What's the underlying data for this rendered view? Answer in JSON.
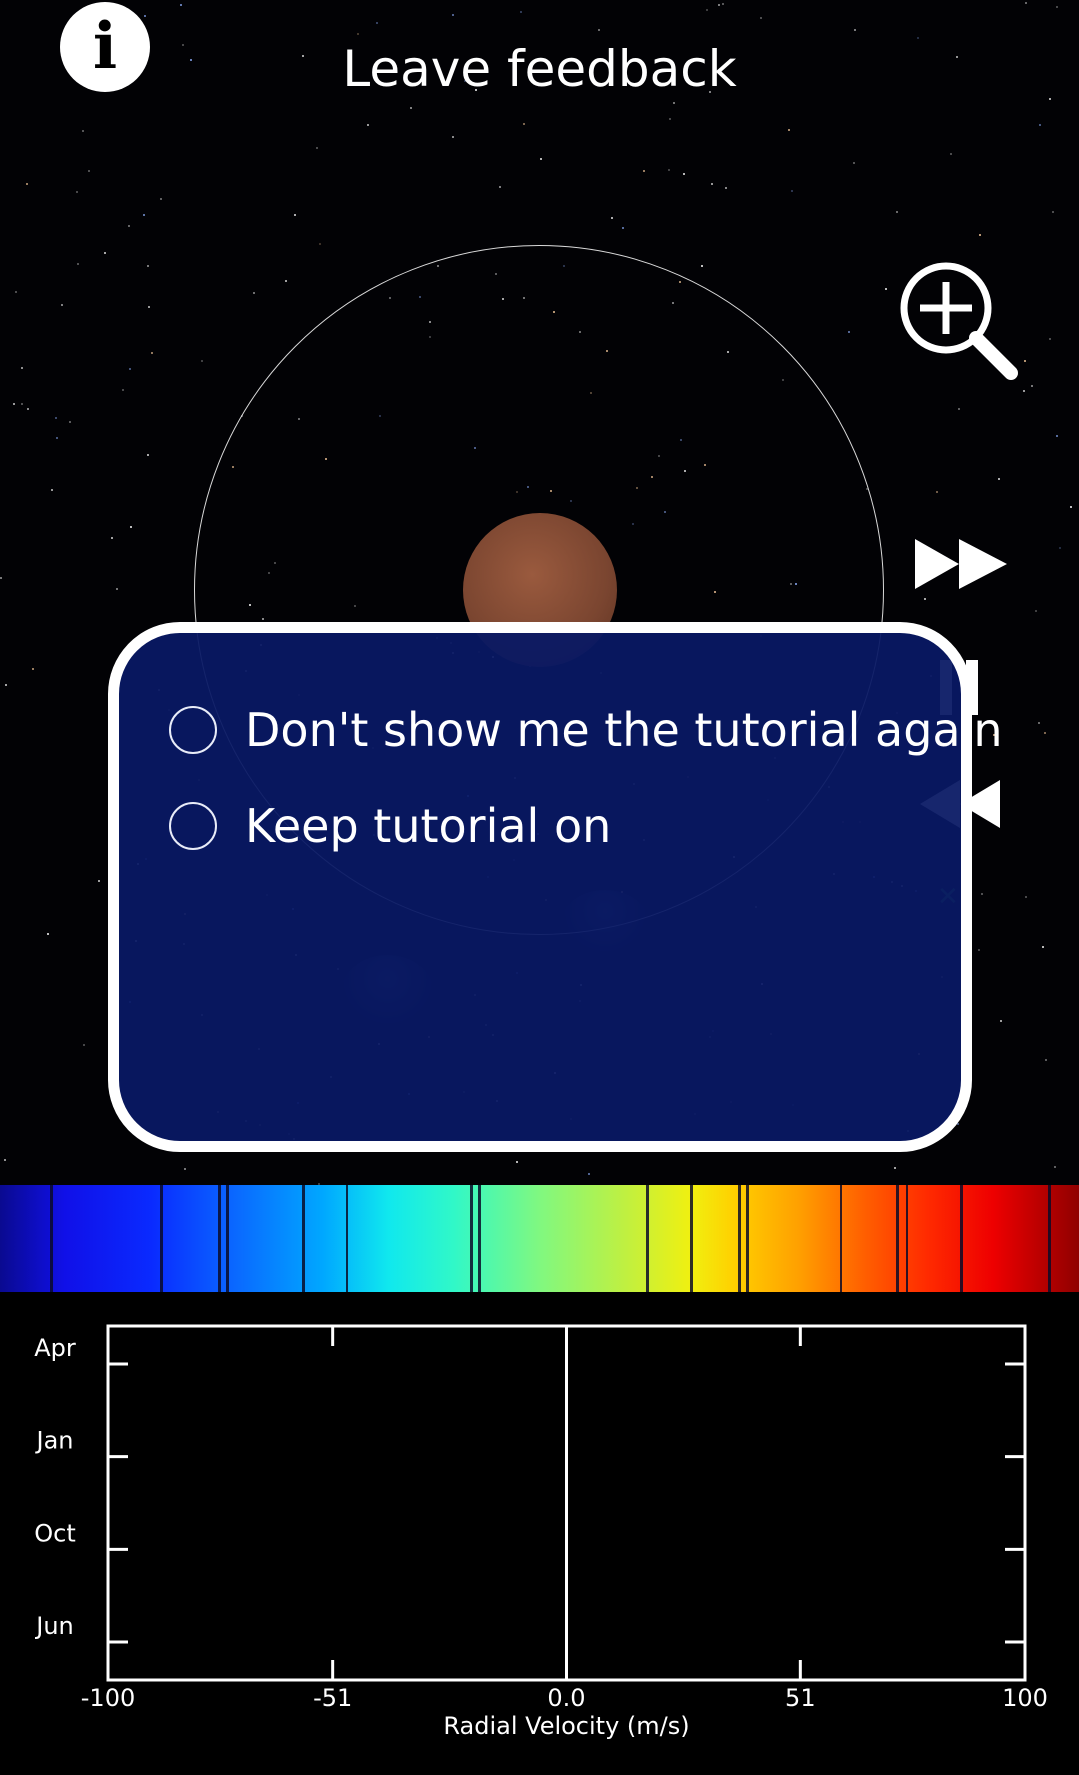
{
  "header": {
    "feedback_label": "Leave feedback"
  },
  "icons": {
    "info": "info-icon",
    "zoom_in": "zoom-in-icon",
    "fast_forward": "fast-forward-icon",
    "pause": "pause-icon",
    "rewind": "rewind-icon"
  },
  "tutorial_dialog": {
    "options": [
      {
        "label": "Don't show me the tutorial again",
        "selected": false
      },
      {
        "label": "Keep tutorial on",
        "selected": false
      }
    ]
  },
  "chart_data": {
    "type": "scatter",
    "title": "",
    "xlabel": "Radial Velocity (m/s)",
    "ylabel": "",
    "xlim": [
      -100,
      100
    ],
    "x_ticks": [
      "-100",
      "-51",
      "0.0",
      "51",
      "100"
    ],
    "x_tick_values": [
      -100,
      -51,
      0,
      51,
      100
    ],
    "y_ticks": [
      "Apr",
      "Jan",
      "Oct",
      "Jun"
    ],
    "series": [],
    "grid": false
  },
  "colors": {
    "dialog_background": "#081864",
    "dialog_border": "#ffffff",
    "background": "#000000"
  }
}
